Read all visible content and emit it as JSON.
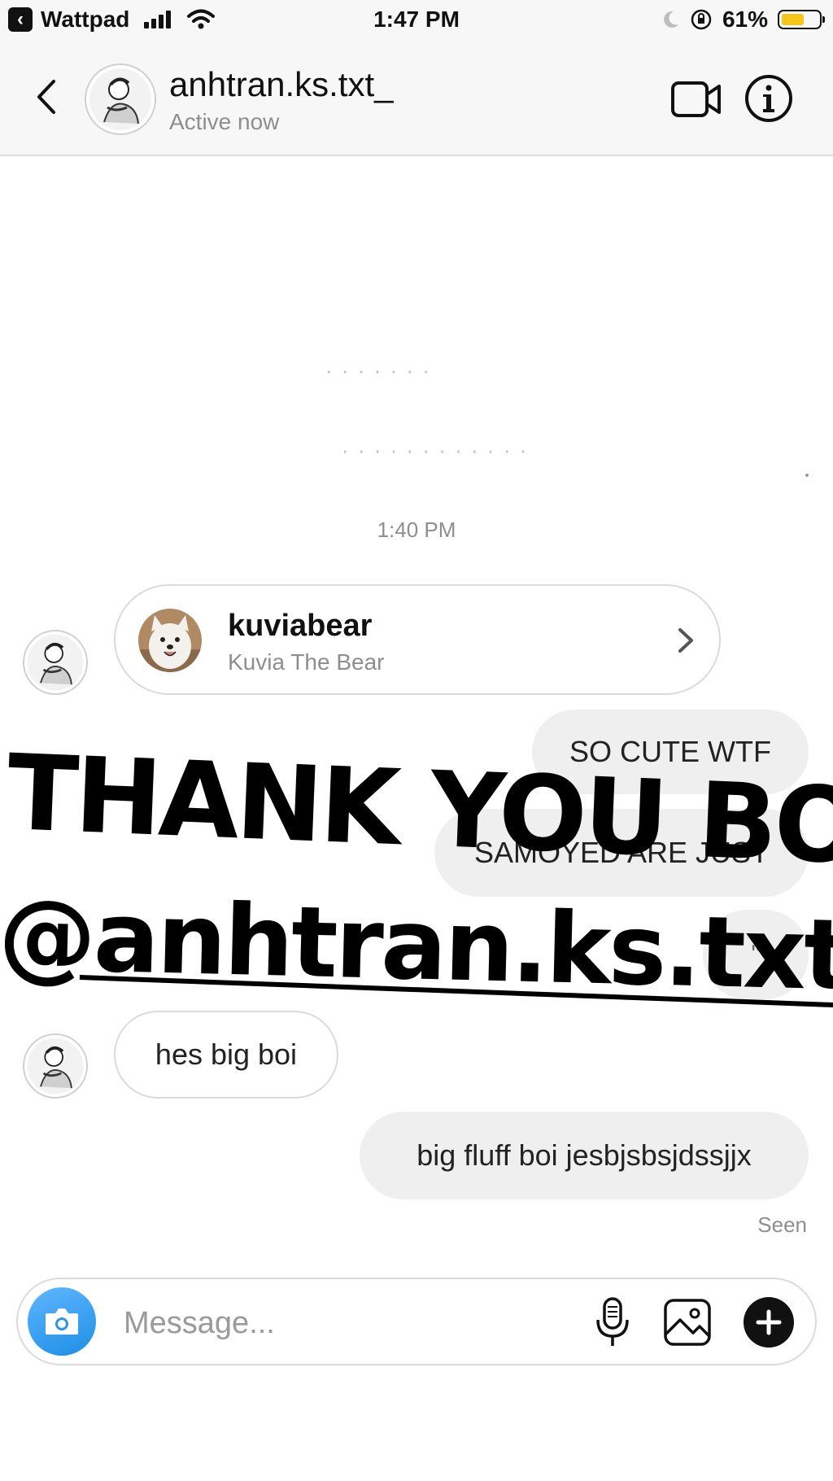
{
  "status_bar": {
    "app": "Wattpad",
    "time": "1:47 PM",
    "battery": "61%",
    "battery_level": 0.61,
    "battery_color": "#f5c518"
  },
  "header": {
    "username": "anhtran.ks.txt_",
    "status": "Active now",
    "icons": [
      "back-chevron-icon",
      "video-call-icon",
      "info-icon"
    ]
  },
  "thread": {
    "timestamp": "1:40 PM",
    "shared_profile": {
      "username": "kuviabear",
      "full_name": "Kuvia The Bear"
    },
    "messages": [
      {
        "from": "me",
        "text": "SO CUTE WTF"
      },
      {
        "from": "me",
        "text": "SAMOYED ARE JUST"
      },
      {
        "from": "me",
        "text": "''"
      },
      {
        "from": "them",
        "text": "hes big boi"
      },
      {
        "from": "me",
        "text": "big fluff boi jesbjsbsjdssjjx"
      }
    ],
    "seen": "Seen"
  },
  "overlay": {
    "line1": "THANK YOU BOI",
    "line2": "@anhtran.ks.txt_"
  },
  "composer": {
    "placeholder": "Message...",
    "value": ""
  },
  "colors": {
    "camera_button": "#1e8fe6",
    "bubble_out": "#efefef",
    "secondary_text": "#8e8e8e"
  }
}
